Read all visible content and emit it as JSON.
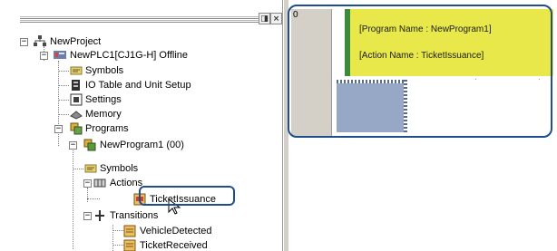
{
  "tree": {
    "items": [
      {
        "label": "NewProject",
        "icon": "project-icon",
        "expander": "minus"
      },
      {
        "label": "NewPLC1[CJ1G-H] Offline",
        "icon": "plc-icon",
        "expander": "minus"
      },
      {
        "label": "Symbols",
        "icon": "symbols-icon"
      },
      {
        "label": "IO Table and Unit Setup",
        "icon": "io-table-icon"
      },
      {
        "label": "Settings",
        "icon": "settings-icon"
      },
      {
        "label": "Memory",
        "icon": "memory-icon"
      },
      {
        "label": "Programs",
        "icon": "programs-icon",
        "expander": "minus"
      },
      {
        "label": "NewProgram1 (00)",
        "icon": "program-icon",
        "expander": "minus"
      },
      {
        "label": "Symbols",
        "icon": "symbols-icon"
      },
      {
        "label": "Actions",
        "icon": "actions-icon",
        "expander": "minus"
      },
      {
        "label": "TicketIssuance",
        "icon": "action-icon",
        "selected": true
      },
      {
        "label": "Transitions",
        "icon": "transitions-icon",
        "expander": "minus"
      },
      {
        "label": "VehicleDetected",
        "icon": "transition-icon"
      },
      {
        "label": "TicketReceived",
        "icon": "transition-icon"
      }
    ],
    "titlebar_buttons": [
      "pin-icon",
      "close-icon"
    ]
  },
  "editor": {
    "row_number": "0",
    "comment_lines": [
      "[Program Name : NewProgram1]",
      "[Action Name : TicketIssuance]"
    ],
    "colors": {
      "comment_bg": "#e8e84a",
      "comment_bar": "#3c8a3c",
      "step_block": "#97a8c6",
      "highlight": "#1f4e8c"
    }
  }
}
